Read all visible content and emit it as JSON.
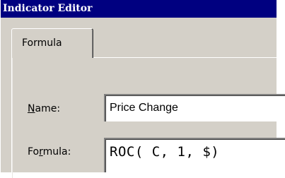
{
  "window": {
    "title": "Indicator Editor"
  },
  "tabs": [
    {
      "label": "Formula",
      "selected": true
    }
  ],
  "fields": {
    "name": {
      "label_pre": "",
      "label_mnemonic": "N",
      "label_post": "ame:",
      "value": "Price Change"
    },
    "formula": {
      "label_pre": "Fo",
      "label_mnemonic": "r",
      "label_post": "mula:",
      "value": "ROC( C, 1, $)"
    }
  },
  "colors": {
    "titlebar": "#000080",
    "face": "#d4d0c8",
    "field_bg": "#ffffff"
  }
}
